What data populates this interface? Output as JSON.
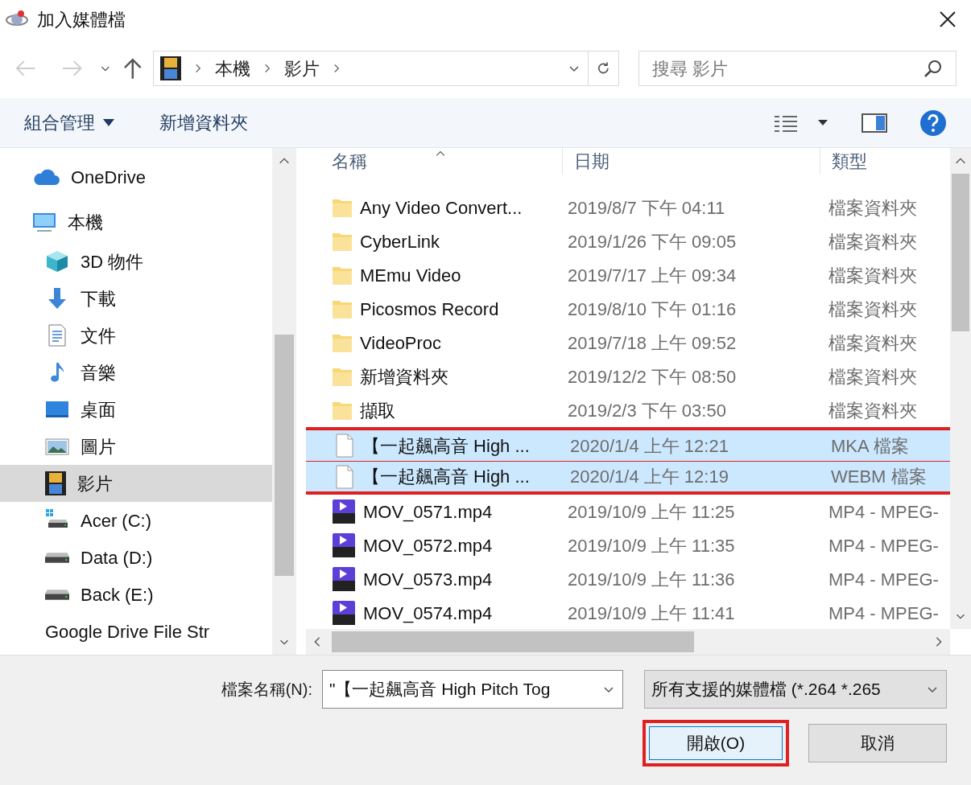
{
  "window": {
    "title": "加入媒體檔"
  },
  "address": {
    "crumbs": [
      "本機",
      "影片"
    ]
  },
  "search": {
    "placeholder": "搜尋 影片"
  },
  "toolbar": {
    "organize": "組合管理",
    "new_folder": "新增資料夾"
  },
  "sidebar": {
    "items": [
      {
        "label": "OneDrive",
        "kind": "cloud",
        "selected": false
      },
      {
        "label": "本機",
        "kind": "computer",
        "selected": false,
        "children": [
          {
            "label": "3D 物件",
            "kind": "cube",
            "selected": false
          },
          {
            "label": "下載",
            "kind": "download",
            "selected": false
          },
          {
            "label": "文件",
            "kind": "document",
            "selected": false
          },
          {
            "label": "音樂",
            "kind": "music",
            "selected": false
          },
          {
            "label": "桌面",
            "kind": "desktop",
            "selected": false
          },
          {
            "label": "圖片",
            "kind": "pictures",
            "selected": false
          },
          {
            "label": "影片",
            "kind": "film",
            "selected": true
          },
          {
            "label": "Acer (C:)",
            "kind": "system-drive",
            "selected": false
          },
          {
            "label": "Data (D:)",
            "kind": "drive",
            "selected": false
          },
          {
            "label": "Back (E:)",
            "kind": "drive",
            "selected": false
          },
          {
            "label": "Google Drive File Str",
            "kind": "none",
            "selected": false
          }
        ]
      }
    ]
  },
  "table": {
    "columns": [
      "名稱",
      "日期",
      "類型"
    ],
    "rows": [
      {
        "name": "Any Video Convert...",
        "date": "2019/8/7 下午 04:11",
        "type": "檔案資料夾",
        "kind": "folder",
        "selected": false,
        "marked": false
      },
      {
        "name": "CyberLink",
        "date": "2019/1/26 下午 09:05",
        "type": "檔案資料夾",
        "kind": "folder",
        "selected": false,
        "marked": false
      },
      {
        "name": "MEmu Video",
        "date": "2019/7/17 上午 09:34",
        "type": "檔案資料夾",
        "kind": "folder",
        "selected": false,
        "marked": false
      },
      {
        "name": "Picosmos Record",
        "date": "2019/8/10 下午 01:16",
        "type": "檔案資料夾",
        "kind": "folder",
        "selected": false,
        "marked": false
      },
      {
        "name": "VideoProc",
        "date": "2019/7/18 上午 09:52",
        "type": "檔案資料夾",
        "kind": "folder",
        "selected": false,
        "marked": false
      },
      {
        "name": "新增資料夾",
        "date": "2019/12/2 下午 08:50",
        "type": "檔案資料夾",
        "kind": "folder",
        "selected": false,
        "marked": false
      },
      {
        "name": "擷取",
        "date": "2019/2/3 下午 03:50",
        "type": "檔案資料夾",
        "kind": "folder",
        "selected": false,
        "marked": false
      },
      {
        "name": "【一起飆高音 High ...",
        "date": "2020/1/4 上午 12:21",
        "type": "MKA 檔案",
        "kind": "file",
        "selected": true,
        "marked": true
      },
      {
        "name": "【一起飆高音 High ...",
        "date": "2020/1/4 上午 12:19",
        "type": "WEBM 檔案",
        "kind": "file",
        "selected": true,
        "marked": true
      },
      {
        "name": "MOV_0571.mp4",
        "date": "2019/10/9 上午 11:25",
        "type": "MP4 - MPEG-",
        "kind": "video",
        "selected": false,
        "marked": false
      },
      {
        "name": "MOV_0572.mp4",
        "date": "2019/10/9 上午 11:35",
        "type": "MP4 - MPEG-",
        "kind": "video",
        "selected": false,
        "marked": false
      },
      {
        "name": "MOV_0573.mp4",
        "date": "2019/10/9 上午 11:36",
        "type": "MP4 - MPEG-",
        "kind": "video",
        "selected": false,
        "marked": false
      },
      {
        "name": "MOV_0574.mp4",
        "date": "2019/10/9 上午 11:41",
        "type": "MP4 - MPEG-",
        "kind": "video",
        "selected": false,
        "marked": false
      }
    ]
  },
  "footer": {
    "filename_label": "檔案名稱(N):",
    "filename_value": "\"【一起飆高音 High Pitch Tog",
    "filter": "所有支援的媒體檔 (*.264 *.265",
    "open": "開啟(O)",
    "open_marked": true,
    "cancel": "取消"
  }
}
